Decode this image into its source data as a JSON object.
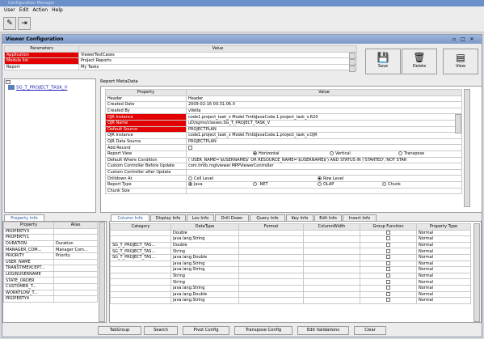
{
  "app": {
    "title": "Configuration Manager",
    "menu": [
      "User",
      "Edit",
      "Action",
      "Help"
    ]
  },
  "frame": {
    "title": "Viewer Configuration",
    "controls": "▫ □ ✕"
  },
  "params": {
    "headers": [
      "Parameters",
      "Value"
    ],
    "rows": [
      [
        "Application",
        "ViewerTestCases"
      ],
      [
        "Module list",
        "Project Reports"
      ],
      [
        "Report",
        "My Tasks"
      ]
    ]
  },
  "actions": {
    "save": "Save",
    "delete": "Delete",
    "view": "View"
  },
  "tree": {
    "node": "SG_T_PROJECT_TASK_V"
  },
  "report_meta": {
    "label": "Report MetaData",
    "headers": [
      "Property",
      "Value"
    ],
    "rows": [
      [
        "Header",
        "Header"
      ],
      [
        "Created Date",
        "2009-02-16 00:31:06.0"
      ],
      [
        "Created By",
        "vVelta"
      ],
      [
        "OJR Instance",
        "code1.project_task_v Model.TmtbJavaCode.1.project_task_v.R20"
      ],
      [
        "OJR Name",
        "uD/sgms/classes.SG_T_PROJECT_TASK_V"
      ],
      [
        "Default Source",
        "PROJECTPLAN"
      ],
      [
        "OJR Instance",
        "code1.project_task_v Model.TmtbJavaCode.1.project_task_v.OJR"
      ],
      [
        "OJR Data Source",
        "PROJECTPLAN"
      ],
      [
        "Add Record",
        ""
      ],
      [
        "Report View",
        ""
      ],
      [
        "Default Where Condition",
        "( USER_NAME='$USERNAME$' OR RESOURCE_NAME='$USERNAME$') AND STATUS IN ('STARTED','NOT STAR"
      ],
      [
        "Custom Controller Before Update",
        "com.tmtb.mgtviewer.MPPViewerController"
      ],
      [
        "Custom Controller after Update",
        ""
      ],
      [
        "Drilldown At",
        ""
      ],
      [
        "Report Type",
        ""
      ],
      [
        "Chunk Size",
        ""
      ]
    ],
    "report_view_opts": [
      "Horizontal",
      "Vertical",
      "Transpose"
    ],
    "drilldown_opts": [
      "Cell Level",
      "Row Level"
    ],
    "report_type_opts": [
      "Java",
      ".NET",
      "OLAP",
      "Chunk"
    ]
  },
  "tabs_left": [
    "Property Info"
  ],
  "property_info": {
    "headers": [
      "Property",
      "Alias"
    ],
    "rows": [
      [
        "PROPERTY3",
        ""
      ],
      [
        "PROPERTY1",
        ""
      ],
      [
        "DURATION",
        "Duration"
      ],
      [
        "MANAGER_COM...",
        "Manager Com..."
      ],
      [
        "PRIORITY",
        "Priority"
      ],
      [
        "USER_NAME",
        ""
      ],
      [
        "TRANSTIMEXCEPT...",
        ""
      ],
      [
        "LOGINUSERNAME",
        ""
      ],
      [
        "STATE_ORDER",
        ""
      ],
      [
        "CUSTOMER_T...",
        ""
      ],
      [
        "WORKFLOW_T...",
        ""
      ],
      [
        "PROPERTY4",
        ""
      ]
    ]
  },
  "tabs_right": [
    "Column Info",
    "Display Info",
    "Lov Info",
    "Drill Down",
    "Query Info",
    "Key Info",
    "Edit Info",
    "Insert Info"
  ],
  "column_info": {
    "headers": [
      "Category",
      "DataType",
      "Format",
      "ColumnWidth",
      "Group Function",
      "Property Type"
    ],
    "rows": [
      [
        "",
        "Double",
        "",
        "",
        "",
        "Normal"
      ],
      [
        "",
        "java.lang.String",
        "",
        "",
        "",
        "Normal"
      ],
      [
        "SG_T_PROJECT_TAS...",
        "Double",
        "",
        "",
        "",
        "Normal"
      ],
      [
        "SG_T_PROJECT_TAS...",
        "String",
        "",
        "",
        "",
        "Normal"
      ],
      [
        "SG_T_PROJECT_TAS...",
        "java.lang.Double",
        "",
        "",
        "",
        "Normal"
      ],
      [
        "",
        "java.lang.String",
        "",
        "",
        "",
        "Normal"
      ],
      [
        "",
        "java.lang.String",
        "",
        "",
        "",
        "Normal"
      ],
      [
        "",
        "String",
        "",
        "",
        "",
        "Normal"
      ],
      [
        "",
        "String",
        "",
        "",
        "",
        "Normal"
      ],
      [
        "",
        "java.lang.String",
        "",
        "",
        "",
        "Normal"
      ],
      [
        "",
        "java.lang.Double",
        "",
        "",
        "",
        "Normal"
      ],
      [
        "",
        "java.lang.String",
        "",
        "",
        "",
        "Normal"
      ]
    ]
  },
  "bottom_buttons": [
    "TabGroup",
    "Search",
    "Pivot Config",
    "Transpose Config",
    "Edit Validations",
    "Clear"
  ]
}
